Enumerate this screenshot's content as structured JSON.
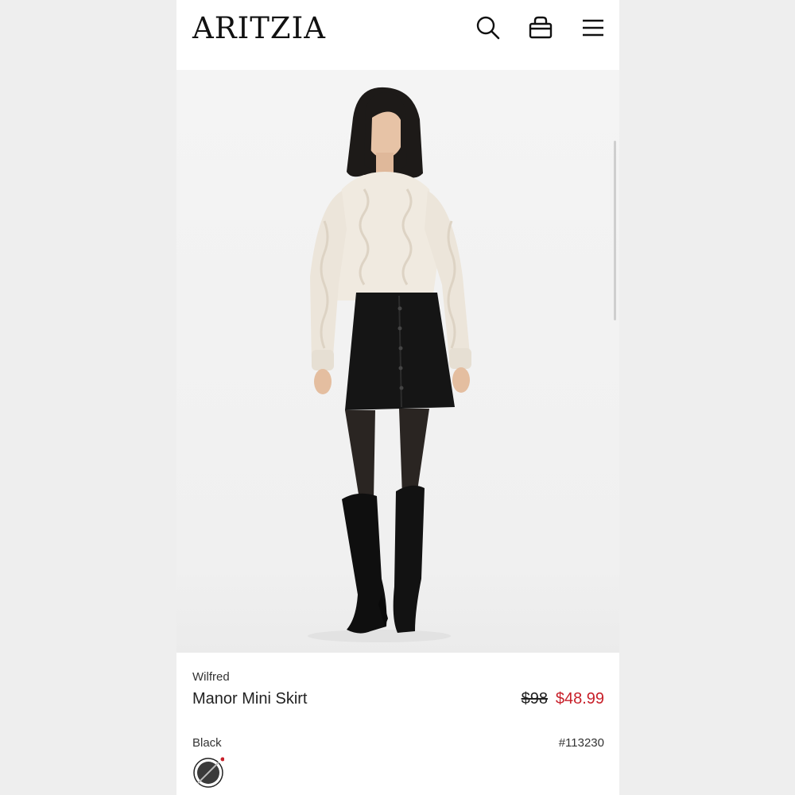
{
  "header": {
    "logo": "ARITZIA",
    "icons": [
      "search-icon",
      "bag-icon",
      "menu-icon"
    ]
  },
  "product": {
    "brand": "Wilfred",
    "name": "Manor Mini Skirt",
    "original_price": "$98",
    "sale_price": "$48.99",
    "color": "Black",
    "sku": "#113230"
  },
  "colors": {
    "sale": "#c8202a",
    "text": "#222222"
  }
}
